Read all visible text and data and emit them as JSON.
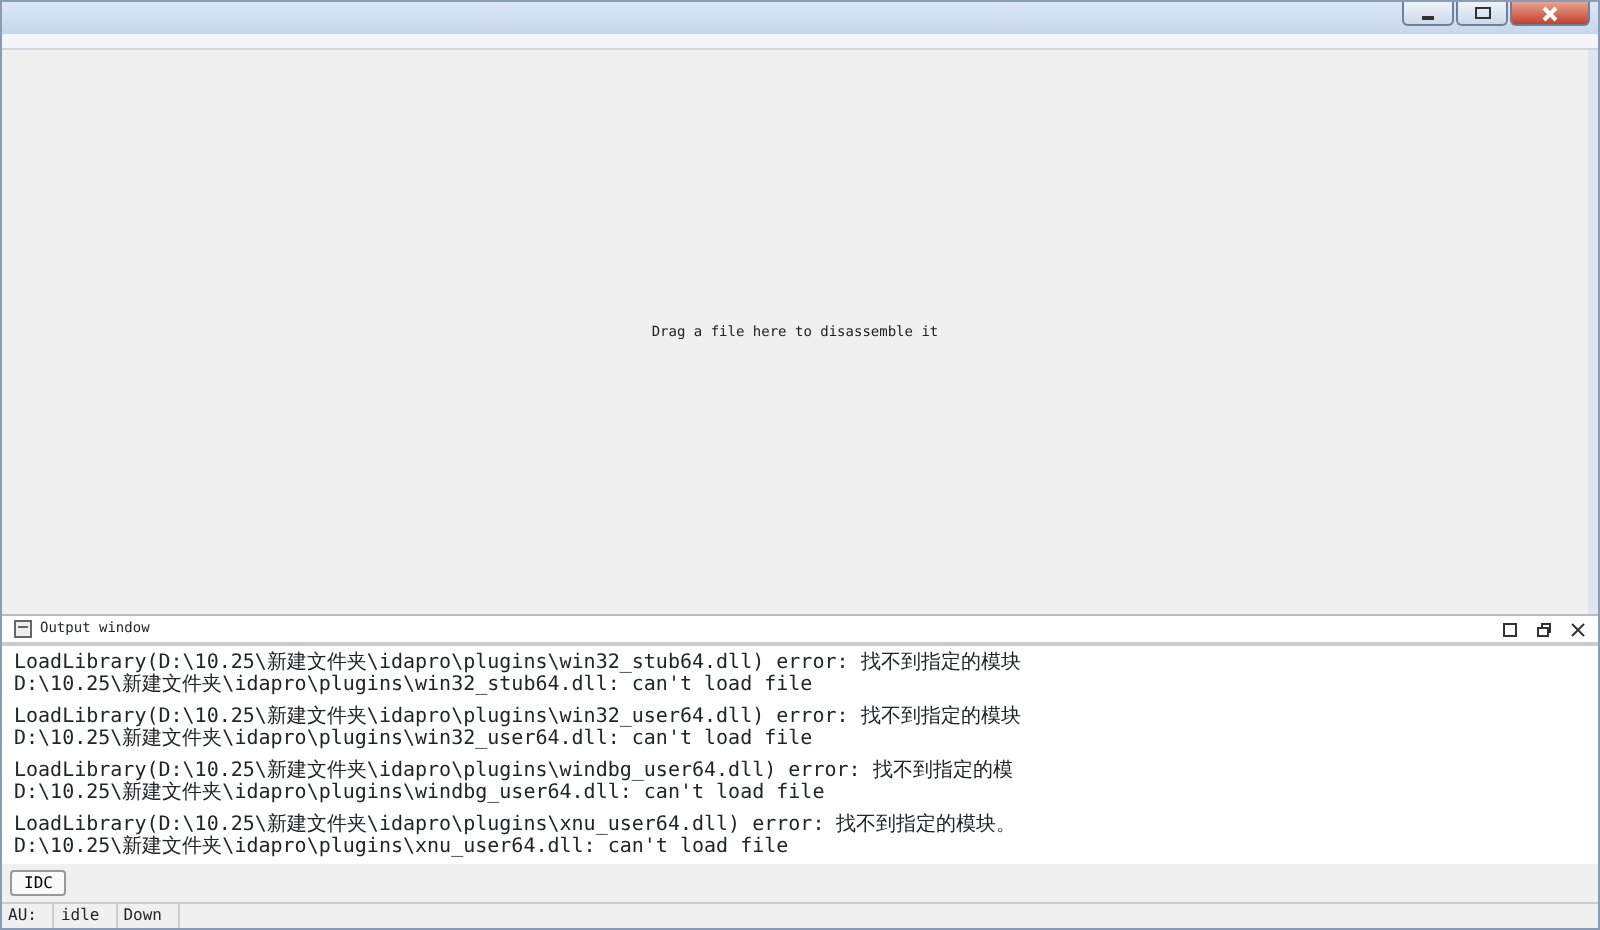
{
  "workspace": {
    "hint": "Drag a file here to disassemble it"
  },
  "output_window": {
    "title": "Output window",
    "groups": [
      {
        "lines": [
          "LoadLibrary(D:\\10.25\\新建文件夹\\idapro\\plugins\\win32_stub64.dll) error: 找不到指定的模块",
          "D:\\10.25\\新建文件夹\\idapro\\plugins\\win32_stub64.dll: can't load file"
        ]
      },
      {
        "lines": [
          "LoadLibrary(D:\\10.25\\新建文件夹\\idapro\\plugins\\win32_user64.dll) error: 找不到指定的模块",
          "D:\\10.25\\新建文件夹\\idapro\\plugins\\win32_user64.dll: can't load file"
        ]
      },
      {
        "lines": [
          "LoadLibrary(D:\\10.25\\新建文件夹\\idapro\\plugins\\windbg_user64.dll) error: 找不到指定的模",
          "D:\\10.25\\新建文件夹\\idapro\\plugins\\windbg_user64.dll: can't load file"
        ]
      },
      {
        "lines": [
          "LoadLibrary(D:\\10.25\\新建文件夹\\idapro\\plugins\\xnu_user64.dll) error: 找不到指定的模块。",
          "D:\\10.25\\新建文件夹\\idapro\\plugins\\xnu_user64.dll: can't load file"
        ]
      }
    ],
    "command_button": "IDC"
  },
  "status_bar": [
    "AU:",
    "idle",
    "Down"
  ]
}
